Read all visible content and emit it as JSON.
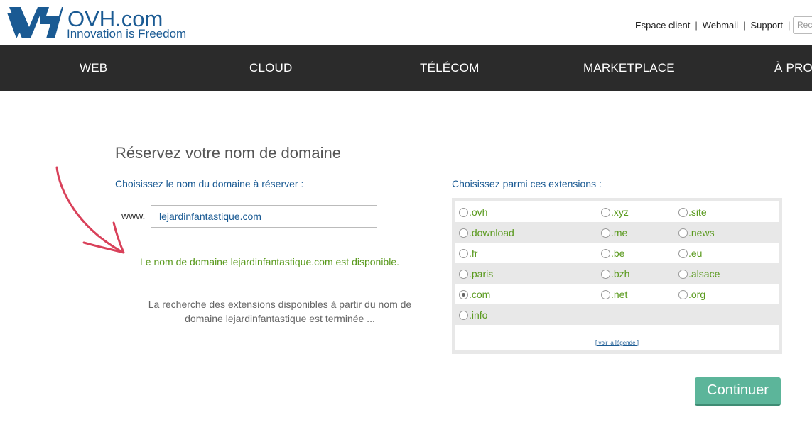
{
  "header": {
    "logo": {
      "name": "OVH.com",
      "tagline": "Innovation is Freedom",
      "icon": "ovh-logo-icon"
    },
    "links": [
      {
        "label": "Espace client"
      },
      {
        "label": "Webmail"
      },
      {
        "label": "Support"
      }
    ],
    "search_placeholder": "Rech"
  },
  "nav": {
    "items": [
      {
        "label": "WEB"
      },
      {
        "label": "CLOUD"
      },
      {
        "label": "TÉLÉCOM"
      },
      {
        "label": "MARKETPLACE"
      },
      {
        "label": "À PROPOS"
      }
    ]
  },
  "main": {
    "title": "Réservez votre nom de domaine",
    "domain_label": "Choisissez le nom du domaine à réserver :",
    "www_prefix": "www.",
    "domain_value": "lejardinfantastique.com",
    "availability": "Le nom de domaine lejardinfantastique.com est disponible.",
    "search_status": "La recherche des extensions disponibles à partir du nom de domaine lejardinfantastique est terminée ...",
    "annotation_icon": "red-arrow-icon"
  },
  "extensions": {
    "label": "Choisissez parmi ces extensions :",
    "rows": [
      [
        ".ovh",
        ".xyz",
        ".site"
      ],
      [
        ".download",
        ".me",
        ".news"
      ],
      [
        ".fr",
        ".be",
        ".eu"
      ],
      [
        ".paris",
        ".bzh",
        ".alsace"
      ],
      [
        ".com",
        ".net",
        ".org"
      ],
      [
        ".info"
      ]
    ],
    "selected": ".com",
    "legend_link": "[ voir la légende ]"
  },
  "actions": {
    "continue_label": "Continuer"
  },
  "colors": {
    "brand_blue": "#1a5a93",
    "nav_bg": "#2b2b2b",
    "available_green": "#5a9a1e",
    "button_teal": "#5cb59a",
    "annotation_red": "#d9415a"
  }
}
